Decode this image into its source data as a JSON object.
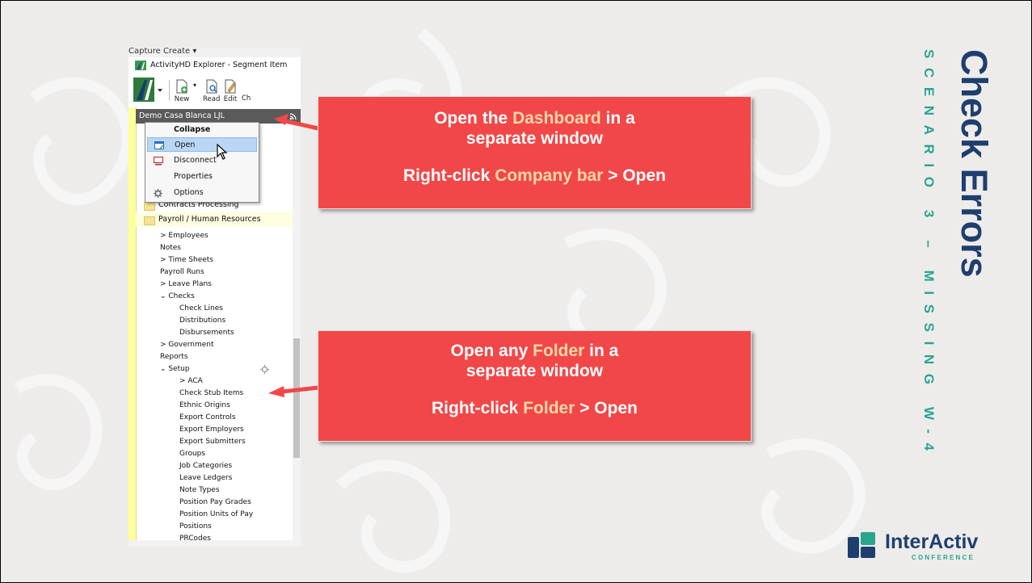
{
  "slide": {
    "title": "Check Errors",
    "subtitle": "SCENARIO 3 – MISSING W-4"
  },
  "callouts": [
    {
      "line1_a": "Open the ",
      "line1_hl": "Dashboard",
      "line1_b": " in a",
      "line2": "separate window",
      "line3_a": "Right-click ",
      "line3_hl": "Company bar",
      "line3_b": " > Open"
    },
    {
      "line1_a": "Open any ",
      "line1_hl": "Folder",
      "line1_b": " in a",
      "line2": "separate window",
      "line3_a": "Right-click ",
      "line3_hl": "Folder",
      "line3_b": " > Open"
    }
  ],
  "app": {
    "menu_text": "Capture   Create ▾",
    "window_title": "ActivityHD Explorer - Segment Item",
    "toolbar": {
      "new": "New",
      "read": "Read",
      "edit": "Edit",
      "partial": "Ch"
    },
    "company_bar": "Demo Casa Blanca LJL",
    "context_menu": [
      "Collapse",
      "Open",
      "Disconnect",
      "Properties",
      "Options"
    ],
    "folders": [
      "Contracts Processing",
      "Payroll / Human Resources"
    ],
    "tree": [
      {
        "label": "> Employees",
        "indent": 0
      },
      {
        "label": "Notes",
        "indent": 0
      },
      {
        "label": "> Time Sheets",
        "indent": 0
      },
      {
        "label": "Payroll Runs",
        "indent": 0
      },
      {
        "label": "> Leave Plans",
        "indent": 0
      },
      {
        "label": "⌄ Checks",
        "indent": 0
      },
      {
        "label": "Check Lines",
        "indent": 1
      },
      {
        "label": "Distributions",
        "indent": 1
      },
      {
        "label": "Disbursements",
        "indent": 1
      },
      {
        "label": "> Government",
        "indent": 0
      },
      {
        "label": "Reports",
        "indent": 0
      },
      {
        "label": "⌄ Setup",
        "indent": 0
      },
      {
        "label": "> ACA",
        "indent": 1
      },
      {
        "label": "Check Stub Items",
        "indent": 1
      },
      {
        "label": "Ethnic Origins",
        "indent": 1
      },
      {
        "label": "Export Controls",
        "indent": 1
      },
      {
        "label": "Export Employers",
        "indent": 1
      },
      {
        "label": "Export Submitters",
        "indent": 1
      },
      {
        "label": "Groups",
        "indent": 1
      },
      {
        "label": "Job Categories",
        "indent": 1
      },
      {
        "label": "Leave Ledgers",
        "indent": 1
      },
      {
        "label": "Note Types",
        "indent": 1
      },
      {
        "label": "Position Pay Grades",
        "indent": 1
      },
      {
        "label": "Position Units of Pay",
        "indent": 1
      },
      {
        "label": "Positions",
        "indent": 1
      },
      {
        "label": "PRCodes",
        "indent": 1
      }
    ]
  },
  "logo": {
    "name": "InterActiv",
    "sub": "CONFERENCE"
  },
  "colors": {
    "callout": "#f24748",
    "highlight": "#ffd7a8",
    "title": "#1e3f6e",
    "subtitle": "#29a58e"
  }
}
